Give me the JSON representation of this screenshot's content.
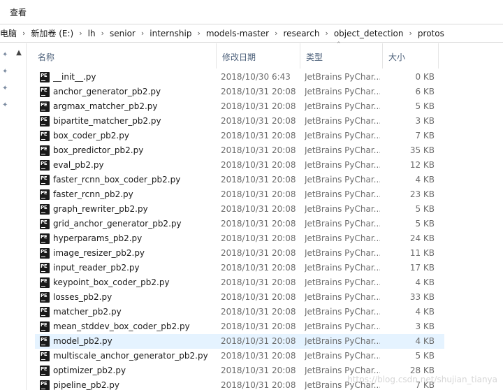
{
  "menu": {
    "view_label": "查看"
  },
  "breadcrumb": [
    "电脑",
    "新加卷 (E:)",
    "lh",
    "senior",
    "internship",
    "models-master",
    "research",
    "object_detection",
    "protos"
  ],
  "nav_pins": [
    "pin-icon",
    "pin-icon",
    "pin-icon",
    "pin-icon"
  ],
  "columns": {
    "name": "名称",
    "date": "修改日期",
    "type": "类型",
    "size": "大小"
  },
  "files": [
    {
      "name": "__init__.py",
      "date": "2018/10/30 6:43",
      "type": "JetBrains PyChar...",
      "size": "0 KB"
    },
    {
      "name": "anchor_generator_pb2.py",
      "date": "2018/10/31 20:08",
      "type": "JetBrains PyChar...",
      "size": "6 KB"
    },
    {
      "name": "argmax_matcher_pb2.py",
      "date": "2018/10/31 20:08",
      "type": "JetBrains PyChar...",
      "size": "5 KB"
    },
    {
      "name": "bipartite_matcher_pb2.py",
      "date": "2018/10/31 20:08",
      "type": "JetBrains PyChar...",
      "size": "3 KB"
    },
    {
      "name": "box_coder_pb2.py",
      "date": "2018/10/31 20:08",
      "type": "JetBrains PyChar...",
      "size": "7 KB"
    },
    {
      "name": "box_predictor_pb2.py",
      "date": "2018/10/31 20:08",
      "type": "JetBrains PyChar...",
      "size": "35 KB"
    },
    {
      "name": "eval_pb2.py",
      "date": "2018/10/31 20:08",
      "type": "JetBrains PyChar...",
      "size": "12 KB"
    },
    {
      "name": "faster_rcnn_box_coder_pb2.py",
      "date": "2018/10/31 20:08",
      "type": "JetBrains PyChar...",
      "size": "4 KB"
    },
    {
      "name": "faster_rcnn_pb2.py",
      "date": "2018/10/31 20:08",
      "type": "JetBrains PyChar...",
      "size": "23 KB"
    },
    {
      "name": "graph_rewriter_pb2.py",
      "date": "2018/10/31 20:08",
      "type": "JetBrains PyChar...",
      "size": "5 KB"
    },
    {
      "name": "grid_anchor_generator_pb2.py",
      "date": "2018/10/31 20:08",
      "type": "JetBrains PyChar...",
      "size": "5 KB"
    },
    {
      "name": "hyperparams_pb2.py",
      "date": "2018/10/31 20:08",
      "type": "JetBrains PyChar...",
      "size": "24 KB"
    },
    {
      "name": "image_resizer_pb2.py",
      "date": "2018/10/31 20:08",
      "type": "JetBrains PyChar...",
      "size": "11 KB"
    },
    {
      "name": "input_reader_pb2.py",
      "date": "2018/10/31 20:08",
      "type": "JetBrains PyChar...",
      "size": "17 KB"
    },
    {
      "name": "keypoint_box_coder_pb2.py",
      "date": "2018/10/31 20:08",
      "type": "JetBrains PyChar...",
      "size": "4 KB"
    },
    {
      "name": "losses_pb2.py",
      "date": "2018/10/31 20:08",
      "type": "JetBrains PyChar...",
      "size": "33 KB"
    },
    {
      "name": "matcher_pb2.py",
      "date": "2018/10/31 20:08",
      "type": "JetBrains PyChar...",
      "size": "4 KB"
    },
    {
      "name": "mean_stddev_box_coder_pb2.py",
      "date": "2018/10/31 20:08",
      "type": "JetBrains PyChar...",
      "size": "3 KB"
    },
    {
      "name": "model_pb2.py",
      "date": "2018/10/31 20:08",
      "type": "JetBrains PyChar...",
      "size": "4 KB",
      "selected": true
    },
    {
      "name": "multiscale_anchor_generator_pb2.py",
      "date": "2018/10/31 20:08",
      "type": "JetBrains PyChar...",
      "size": "5 KB"
    },
    {
      "name": "optimizer_pb2.py",
      "date": "2018/10/31 20:08",
      "type": "JetBrains PyChar...",
      "size": "28 KB"
    },
    {
      "name": "pipeline_pb2.py",
      "date": "2018/10/31 20:08",
      "type": "JetBrains PyChar...",
      "size": "7 KB"
    }
  ],
  "file_icon_label": "PE",
  "watermark": "https://blog.csdn.net/shujian_tianya",
  "colors": {
    "selected_row": "#e5f3ff",
    "header_text": "#4c607a",
    "secondary_text": "#6d6d6d"
  }
}
